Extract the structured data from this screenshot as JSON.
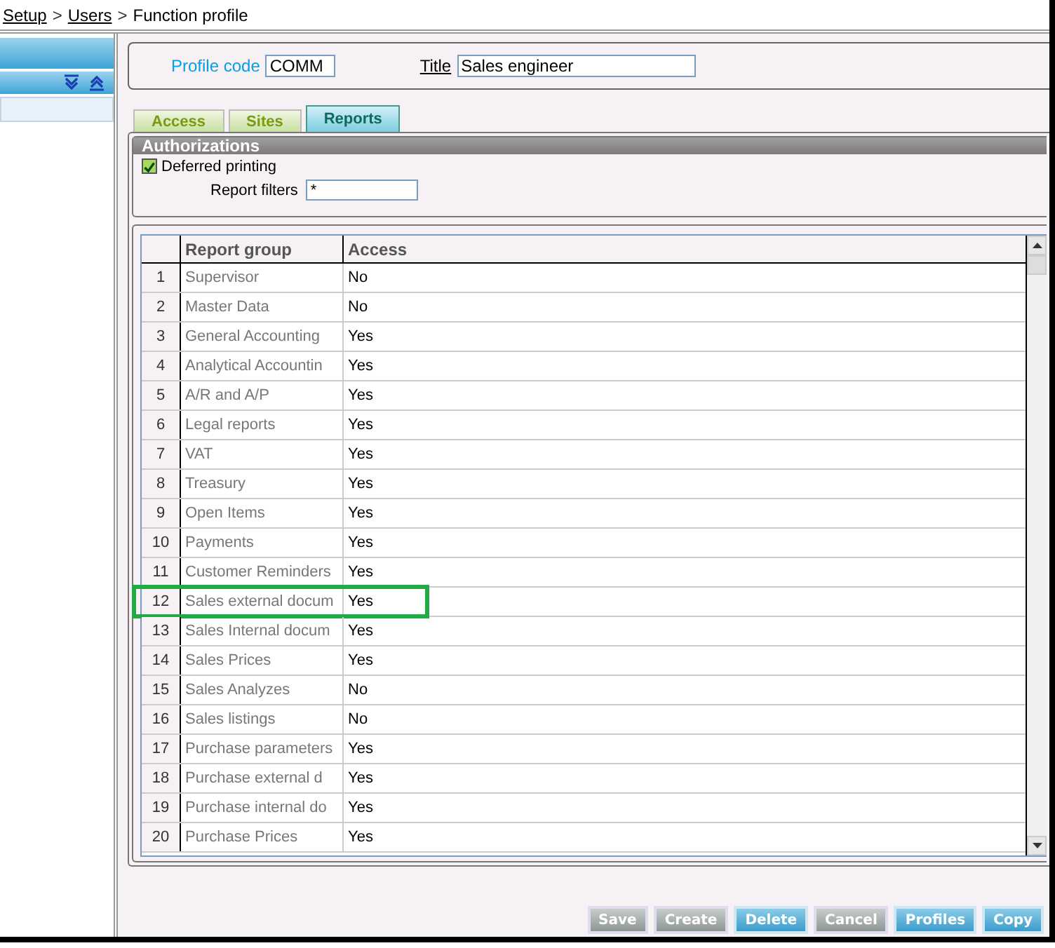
{
  "breadcrumb": [
    {
      "label": "Setup",
      "link": true
    },
    {
      "label": "Users",
      "link": true
    },
    {
      "label": "Function profile",
      "link": false
    }
  ],
  "breadcrumb_separator": ">",
  "profile": {
    "code_label": "Profile code",
    "code": "COMM",
    "title_label": "Title",
    "title": "Sales engineer"
  },
  "tabs": [
    {
      "label": "Access",
      "selected": false
    },
    {
      "label": "Sites",
      "selected": false
    },
    {
      "label": "Reports",
      "selected": true
    }
  ],
  "authorizations": {
    "title": "Authorizations",
    "deferred_printing": {
      "label": "Deferred printing",
      "checked": true
    },
    "report_filters": {
      "label": "Report filters",
      "value": "*"
    }
  },
  "table": {
    "columns": [
      "Report group",
      "Access"
    ],
    "rows": [
      {
        "num": "1",
        "group": "Supervisor",
        "access": "No",
        "highlighted": false
      },
      {
        "num": "2",
        "group": "Master Data",
        "access": "No",
        "highlighted": false
      },
      {
        "num": "3",
        "group": "General Accounting",
        "access": "Yes",
        "highlighted": false
      },
      {
        "num": "4",
        "group": "Analytical Accountin",
        "access": "Yes",
        "highlighted": false
      },
      {
        "num": "5",
        "group": "A/R and A/P",
        "access": "Yes",
        "highlighted": false
      },
      {
        "num": "6",
        "group": "Legal reports",
        "access": "Yes",
        "highlighted": false
      },
      {
        "num": "7",
        "group": "VAT",
        "access": "Yes",
        "highlighted": false
      },
      {
        "num": "8",
        "group": "Treasury",
        "access": "Yes",
        "highlighted": false
      },
      {
        "num": "9",
        "group": "Open Items",
        "access": "Yes",
        "highlighted": false
      },
      {
        "num": "10",
        "group": "Payments",
        "access": "Yes",
        "highlighted": false
      },
      {
        "num": "11",
        "group": "Customer Reminders",
        "access": "Yes",
        "highlighted": false
      },
      {
        "num": "12",
        "group": "Sales external docum",
        "access": "Yes",
        "highlighted": true
      },
      {
        "num": "13",
        "group": "Sales Internal docum",
        "access": "Yes",
        "highlighted": false
      },
      {
        "num": "14",
        "group": "Sales Prices",
        "access": "Yes",
        "highlighted": false
      },
      {
        "num": "15",
        "group": "Sales Analyzes",
        "access": "No",
        "highlighted": false
      },
      {
        "num": "16",
        "group": "Sales listings",
        "access": "No",
        "highlighted": false
      },
      {
        "num": "17",
        "group": "Purchase parameters",
        "access": "Yes",
        "highlighted": false
      },
      {
        "num": "18",
        "group": "Purchase external d",
        "access": "Yes",
        "highlighted": false
      },
      {
        "num": "19",
        "group": "Purchase internal do",
        "access": "Yes",
        "highlighted": false
      },
      {
        "num": "20",
        "group": "Purchase Prices",
        "access": "Yes",
        "highlighted": false
      }
    ]
  },
  "buttons": [
    {
      "label": "Save",
      "disabled": true
    },
    {
      "label": "Create",
      "disabled": true
    },
    {
      "label": "Delete",
      "disabled": false
    },
    {
      "label": "Cancel",
      "disabled": true
    },
    {
      "label": "Profiles",
      "disabled": false
    },
    {
      "label": "Copy",
      "disabled": false
    }
  ]
}
